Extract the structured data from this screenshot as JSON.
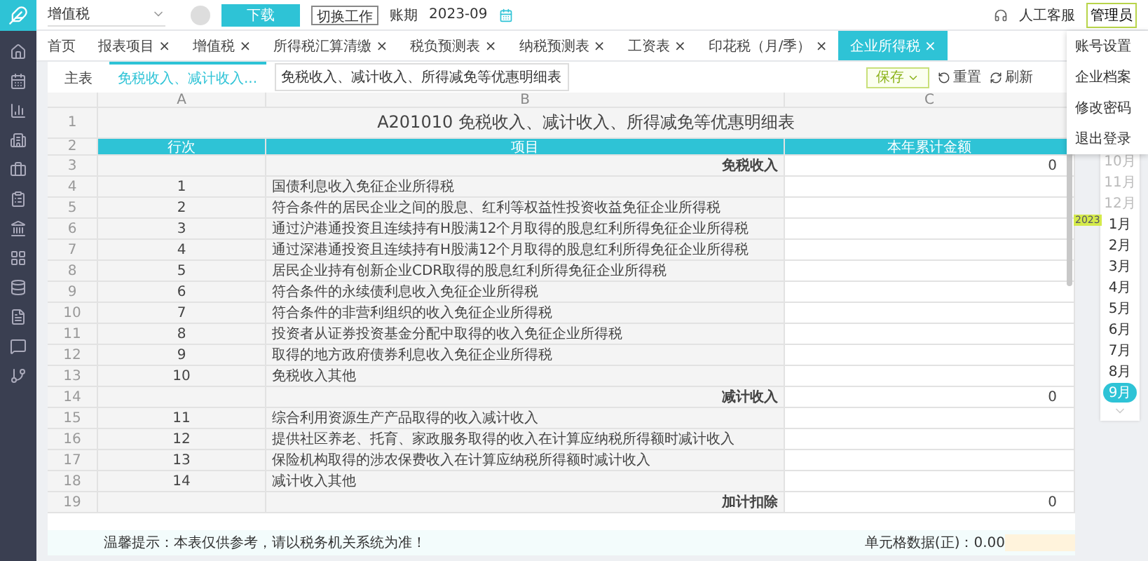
{
  "topbar": {
    "company": "增值税",
    "download_button": "下载",
    "switch_button": "切换工作",
    "period_label": "账期",
    "period": "2023-09",
    "support": "人工客服",
    "user": "管理员"
  },
  "user_menu": [
    "账号设置",
    "企业档案",
    "修改密码",
    "退出登录"
  ],
  "tabs": [
    {
      "label": "首页",
      "selected": false
    },
    {
      "label": "报表项目",
      "close": "×",
      "selected": false
    },
    {
      "label": "增值税",
      "close": "×",
      "selected": false
    },
    {
      "label": "所得税汇算清缴",
      "close": "×",
      "selected": false
    },
    {
      "label": "税负预测表",
      "close": "×",
      "selected": false
    },
    {
      "label": "纳税预测表",
      "close": "×",
      "selected": false
    },
    {
      "label": "工资表",
      "close": "×",
      "selected": false
    },
    {
      "label": "印花税（月/季）",
      "close": "×",
      "selected": false
    },
    {
      "label": "企业所得税",
      "close": "×",
      "selected": true
    }
  ],
  "sheet_tabs": [
    {
      "label": "主表",
      "selected": false
    },
    {
      "label": "免税收入、减计收入...",
      "selected": true
    }
  ],
  "tooltip": "免税收入、减计收入、所得减免等优惠明细表",
  "toolbar": {
    "save": "保存",
    "reset": "重置",
    "refresh": "刷新"
  },
  "sheet": {
    "columns": [
      "A",
      "B",
      "C"
    ],
    "title_row": "1",
    "title": "A201010 免税收入、减计收入、所得减免等优惠明细表",
    "header_row": "2",
    "header": [
      "行次",
      "项目",
      "本年累计金额"
    ],
    "rows": [
      {
        "n": "3",
        "seq": "",
        "item": "免税收入",
        "value": "0",
        "kind": "section"
      },
      {
        "n": "4",
        "seq": "1",
        "item": "国债利息收入免征企业所得税",
        "value": "",
        "kind": "line"
      },
      {
        "n": "5",
        "seq": "2",
        "item": "符合条件的居民企业之间的股息、红利等权益性投资收益免征企业所得税",
        "value": "",
        "kind": "line"
      },
      {
        "n": "6",
        "seq": "3",
        "item": "通过沪港通投资且连续持有H股满12个月取得的股息红利所得免征企业所得税",
        "value": "",
        "kind": "line"
      },
      {
        "n": "7",
        "seq": "4",
        "item": "通过深港通投资且连续持有H股满12个月取得的股息红利所得免征企业所得税",
        "value": "",
        "kind": "line"
      },
      {
        "n": "8",
        "seq": "5",
        "item": "居民企业持有创新企业CDR取得的股息红利所得免征企业所得税",
        "value": "",
        "kind": "line"
      },
      {
        "n": "9",
        "seq": "6",
        "item": "符合条件的永续债利息收入免征企业所得税",
        "value": "",
        "kind": "line"
      },
      {
        "n": "10",
        "seq": "7",
        "item": "符合条件的非营利组织的收入免征企业所得税",
        "value": "",
        "kind": "line"
      },
      {
        "n": "11",
        "seq": "8",
        "item": "投资者从证券投资基金分配中取得的收入免征企业所得税",
        "value": "",
        "kind": "line"
      },
      {
        "n": "12",
        "seq": "9",
        "item": "取得的地方政府债券利息收入免征企业所得税",
        "value": "",
        "kind": "line"
      },
      {
        "n": "13",
        "seq": "10",
        "item": "免税收入其他",
        "value": "",
        "kind": "line"
      },
      {
        "n": "14",
        "seq": "",
        "item": "减计收入",
        "value": "0",
        "kind": "section"
      },
      {
        "n": "15",
        "seq": "11",
        "item": "综合利用资源生产产品取得的收入减计收入",
        "value": "",
        "kind": "line"
      },
      {
        "n": "16",
        "seq": "12",
        "item": "提供社区养老、托育、家政服务取得的收入在计算应纳税所得额时减计收入",
        "value": "",
        "kind": "line"
      },
      {
        "n": "17",
        "seq": "13",
        "item": "保险机构取得的涉农保费收入在计算应纳税所得额时减计收入",
        "value": "",
        "kind": "line"
      },
      {
        "n": "18",
        "seq": "14",
        "item": "减计收入其他",
        "value": "",
        "kind": "line"
      },
      {
        "n": "19",
        "seq": "",
        "item": "加计扣除",
        "value": "0",
        "kind": "section"
      }
    ]
  },
  "months": [
    {
      "label": "10月",
      "disabled": true,
      "selected": false
    },
    {
      "label": "11月",
      "disabled": true,
      "selected": false
    },
    {
      "label": "12月",
      "disabled": true,
      "selected": false
    },
    {
      "label": "1月",
      "disabled": false,
      "selected": false,
      "year": "2023"
    },
    {
      "label": "2月",
      "disabled": false,
      "selected": false
    },
    {
      "label": "3月",
      "disabled": false,
      "selected": false
    },
    {
      "label": "4月",
      "disabled": false,
      "selected": false
    },
    {
      "label": "5月",
      "disabled": false,
      "selected": false
    },
    {
      "label": "6月",
      "disabled": false,
      "selected": false
    },
    {
      "label": "7月",
      "disabled": false,
      "selected": false
    },
    {
      "label": "8月",
      "disabled": false,
      "selected": false
    },
    {
      "label": "9月",
      "disabled": false,
      "selected": true
    }
  ],
  "footer": {
    "notice": "温馨提示：本表仅供参考，请以税务机关系统为准！",
    "cell_label": "单元格数据(正)：0.00"
  }
}
